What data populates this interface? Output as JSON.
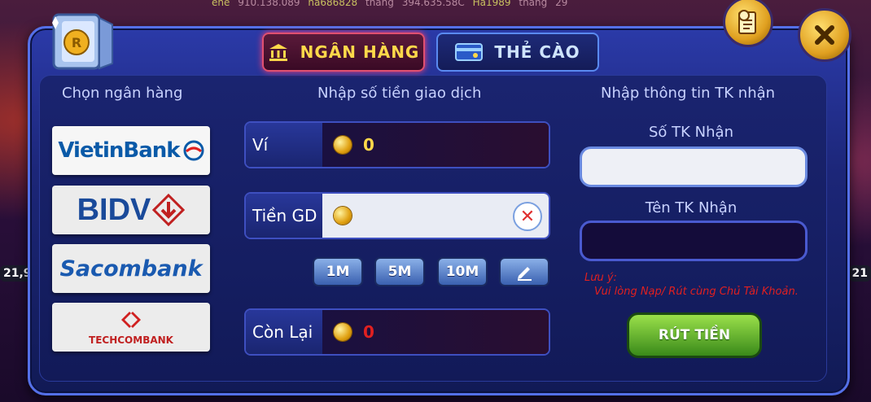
{
  "ticker": [
    {
      "user": "ene",
      "amount": "910.138.089",
      "suffix": ""
    },
    {
      "user": "ha686828",
      "amount": "394.635.58C",
      "suffix": "thắng"
    },
    {
      "user": "Ha1989",
      "amount": "29",
      "suffix": "thắng"
    }
  ],
  "side": {
    "left_num": "21,9",
    "right_num": "21"
  },
  "tabs": {
    "bank": "NGÂN HÀNG",
    "card": "THẺ CÀO"
  },
  "columns": {
    "banks_title": "Chọn ngân hàng",
    "amount_title": "Nhập số tiền giao dịch",
    "receiver_title": "Nhập thông tin TK nhận"
  },
  "banks": [
    {
      "name": "VietinBank"
    },
    {
      "name": "BIDV"
    },
    {
      "name": "Sacombank"
    },
    {
      "name": "TECHCOMBANK"
    }
  ],
  "wallet": {
    "label": "Ví",
    "value": "0"
  },
  "amount_input": {
    "label": "Tiền GD",
    "value": ""
  },
  "quick_amounts": [
    "1M",
    "5M",
    "10M"
  ],
  "remaining": {
    "label": "Còn Lại",
    "value": "0"
  },
  "receiver": {
    "account_number_label": "Số TK Nhận",
    "account_number_value": "",
    "account_name_label": "Tên TK Nhận",
    "account_name_value": ""
  },
  "note": {
    "title": "Lưu ý:",
    "text": "Vui lòng Nạp/ Rút cùng Chủ Tài Khoản."
  },
  "withdraw_button": "RÚT TIỀN",
  "colors": {
    "active_tab": "#ffd84a",
    "note": "#e02020",
    "withdraw": "#6ab830",
    "remaining_value": "#e02020",
    "wallet_value": "#ffd84a"
  }
}
